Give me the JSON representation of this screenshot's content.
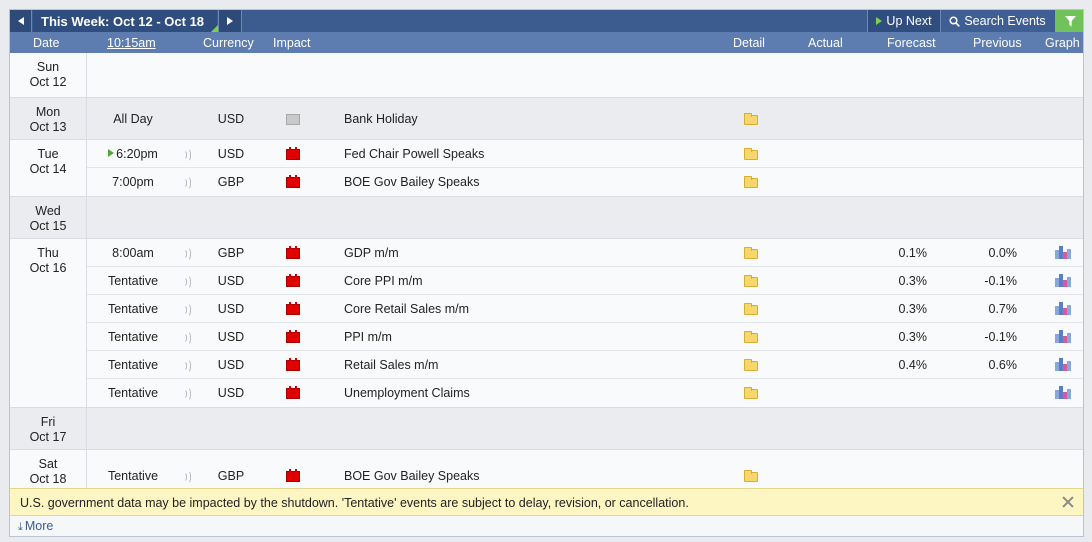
{
  "toolbar": {
    "prev_icon": "triangle-left-icon",
    "week_title": "This Week: Oct 12 - Oct 18",
    "next_icon": "triangle-right-icon",
    "up_next_label": "Up Next",
    "search_events_label": "Search Events",
    "filter_icon": "filter-funnel-icon",
    "accent_color": "#3c5b8f",
    "filter_color": "#72c25b"
  },
  "columns": {
    "date": "Date",
    "time": "10:15am",
    "currency": "Currency",
    "impact": "Impact",
    "detail": "Detail",
    "actual": "Actual",
    "forecast": "Forecast",
    "previous": "Previous",
    "graph": "Graph"
  },
  "days": [
    {
      "weekday": "Sun",
      "date": "Oct 12",
      "events": []
    },
    {
      "weekday": "Mon",
      "date": "Oct 13",
      "events": [
        {
          "time": "All Day",
          "currency": "USD",
          "impact": "non-economic",
          "event": "Bank Holiday",
          "forecast": "",
          "previous": "",
          "graph": false
        }
      ]
    },
    {
      "weekday": "Tue",
      "date": "Oct 14",
      "events": [
        {
          "time": "6:20pm",
          "next": true,
          "currency": "USD",
          "impact": "high",
          "event": "Fed Chair Powell Speaks",
          "forecast": "",
          "previous": "",
          "graph": false
        },
        {
          "time": "7:00pm",
          "currency": "GBP",
          "impact": "high",
          "event": "BOE Gov Bailey Speaks",
          "forecast": "",
          "previous": "",
          "graph": false
        }
      ]
    },
    {
      "weekday": "Wed",
      "date": "Oct 15",
      "events": []
    },
    {
      "weekday": "Thu",
      "date": "Oct 16",
      "events": [
        {
          "time": "8:00am",
          "currency": "GBP",
          "impact": "high",
          "event": "GDP m/m",
          "forecast": "0.1%",
          "previous": "0.0%",
          "graph": true
        },
        {
          "time": "Tentative",
          "currency": "USD",
          "impact": "high",
          "event": "Core PPI m/m",
          "forecast": "0.3%",
          "previous": "-0.1%",
          "graph": true
        },
        {
          "time": "Tentative",
          "currency": "USD",
          "impact": "high",
          "event": "Core Retail Sales m/m",
          "forecast": "0.3%",
          "previous": "0.7%",
          "graph": true
        },
        {
          "time": "Tentative",
          "currency": "USD",
          "impact": "high",
          "event": "PPI m/m",
          "forecast": "0.3%",
          "previous": "-0.1%",
          "graph": true
        },
        {
          "time": "Tentative",
          "currency": "USD",
          "impact": "high",
          "event": "Retail Sales m/m",
          "forecast": "0.4%",
          "previous": "0.6%",
          "graph": true
        },
        {
          "time": "Tentative",
          "currency": "USD",
          "impact": "high",
          "event": "Unemployment Claims",
          "forecast": "",
          "previous": "",
          "graph": true
        }
      ]
    },
    {
      "weekday": "Fri",
      "date": "Oct 17",
      "events": []
    },
    {
      "weekday": "Sat",
      "date": "Oct 18",
      "events": [
        {
          "time": "Tentative",
          "currency": "GBP",
          "impact": "high",
          "event": "BOE Gov Bailey Speaks",
          "forecast": "",
          "previous": "",
          "graph": false
        }
      ]
    }
  ],
  "notice": {
    "text": "U.S. government data may be impacted by the shutdown. 'Tentative' events are subject to delay, revision, or cancellation.",
    "close_icon": "close-x-icon"
  },
  "footer": {
    "more_label": "More",
    "more_icon": "download-arrow-icon"
  }
}
